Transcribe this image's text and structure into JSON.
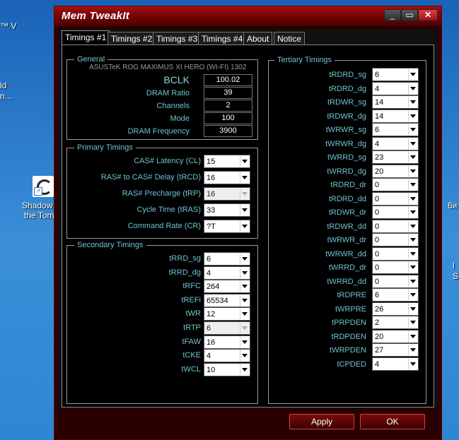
{
  "desktop": {
    "left_fragments": [
      "™ V",
      "ld",
      "n..."
    ],
    "shortcut_label_line1": "Shadow",
    "shortcut_label_line2": "the Tom",
    "right_fragment_1": "6и",
    "right_fragment_2": "l",
    "right_fragment_3": "S"
  },
  "window": {
    "title": "Mem TweakIt",
    "min_glyph": "_",
    "max_glyph": "▭",
    "close_glyph": "✕"
  },
  "tabs": [
    "Timings #1",
    "Timings #2",
    "Timings #3",
    "Timings #4",
    "About",
    "Notice"
  ],
  "general": {
    "title": "General",
    "board": "ASUSTeK ROG MAXIMUS XI HERO (WI-FI) 1302",
    "rows": [
      {
        "label": "BCLK",
        "value": "100.02"
      },
      {
        "label": "DRAM Ratio",
        "value": "39"
      },
      {
        "label": "Channels",
        "value": "2"
      },
      {
        "label": "Mode",
        "value": "100"
      },
      {
        "label": "DRAM Frequency",
        "value": "3900"
      }
    ]
  },
  "primary": {
    "title": "Primary Timings",
    "rows": [
      {
        "label": "CAS# Latency (CL)",
        "value": "15",
        "enabled": true
      },
      {
        "label": "RAS# to CAS# Delay (tRCD)",
        "value": "16",
        "enabled": true
      },
      {
        "label": "RAS# Precharge (tRP)",
        "value": "16",
        "enabled": false
      },
      {
        "label": "Cycle Time (tRAS)",
        "value": "33",
        "enabled": true
      },
      {
        "label": "Command Rate (CR)",
        "value": "?T",
        "enabled": true
      }
    ]
  },
  "secondary": {
    "title": "Secondary Timings",
    "rows": [
      {
        "label": "tRRD_sg",
        "value": "6",
        "enabled": true
      },
      {
        "label": "tRRD_dg",
        "value": "4",
        "enabled": true
      },
      {
        "label": "tRFC",
        "value": "264",
        "enabled": true
      },
      {
        "label": "tREFi",
        "value": "65534",
        "enabled": true
      },
      {
        "label": "tWR",
        "value": "12",
        "enabled": true
      },
      {
        "label": "tRTP",
        "value": "6",
        "enabled": false
      },
      {
        "label": "tFAW",
        "value": "16",
        "enabled": true
      },
      {
        "label": "tCKE",
        "value": "4",
        "enabled": true
      },
      {
        "label": "tWCL",
        "value": "10",
        "enabled": true
      }
    ]
  },
  "tertiary": {
    "title": "Tertiary Timings",
    "rows": [
      {
        "label": "tRDRD_sg",
        "value": "6"
      },
      {
        "label": "tRDRD_dg",
        "value": "4"
      },
      {
        "label": "tRDWR_sg",
        "value": "14"
      },
      {
        "label": "tRDWR_dg",
        "value": "14"
      },
      {
        "label": "tWRWR_sg",
        "value": "6"
      },
      {
        "label": "tWRWR_dg",
        "value": "4"
      },
      {
        "label": "tWRRD_sg",
        "value": "23"
      },
      {
        "label": "tWRRD_dg",
        "value": "20"
      },
      {
        "label": "tRDRD_dr",
        "value": "0"
      },
      {
        "label": "tRDRD_dd",
        "value": "0"
      },
      {
        "label": "tRDWR_dr",
        "value": "0"
      },
      {
        "label": "tRDWR_dd",
        "value": "0"
      },
      {
        "label": "tWRWR_dr",
        "value": "0"
      },
      {
        "label": "tWRWR_dd",
        "value": "0"
      },
      {
        "label": "tWRRD_dr",
        "value": "0"
      },
      {
        "label": "tWRRD_dd",
        "value": "0"
      },
      {
        "label": "tRDPRE",
        "value": "6"
      },
      {
        "label": "tWRPRE",
        "value": "26"
      },
      {
        "label": "tPRPDEN",
        "value": "2"
      },
      {
        "label": "tRDPDEN",
        "value": "20"
      },
      {
        "label": "tWRPDEN",
        "value": "27"
      },
      {
        "label": "tCPDED",
        "value": "4"
      }
    ]
  },
  "buttons": {
    "apply": "Apply",
    "ok": "OK"
  }
}
